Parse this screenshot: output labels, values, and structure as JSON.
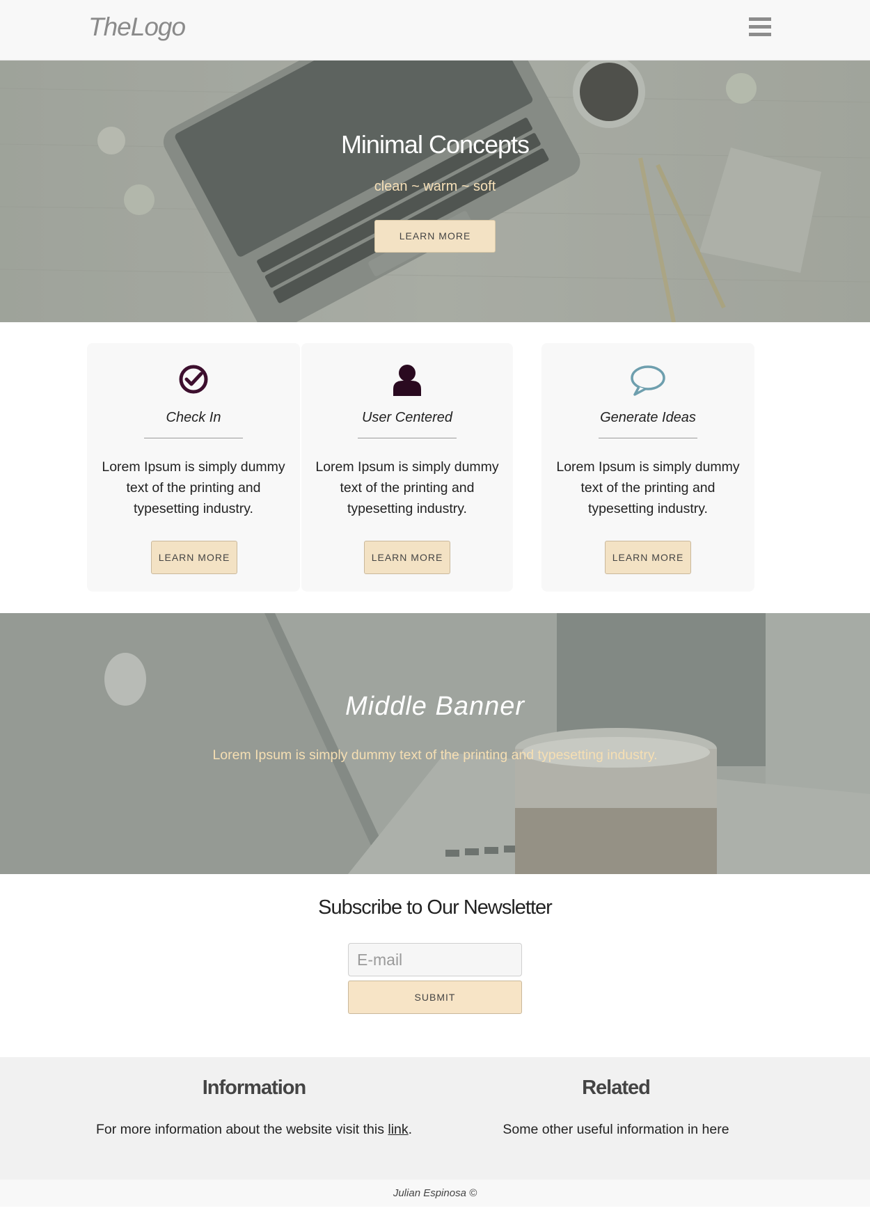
{
  "header": {
    "logo": "TheLogo",
    "menu_icon": "hamburger-menu-icon"
  },
  "hero": {
    "title": "Minimal Concepts",
    "subtitle": "clean ~ warm ~ soft",
    "button_label": "LEARN MORE"
  },
  "features": [
    {
      "icon": "check-circle-icon",
      "title": "Check In",
      "text": "Lorem Ipsum is simply dummy text of the printing and typesetting industry.",
      "button_label": "LEARN MORE"
    },
    {
      "icon": "user-icon",
      "title": "User Centered",
      "text": "Lorem Ipsum is simply dummy text of the printing and typesetting industry.",
      "button_label": "LEARN MORE"
    },
    {
      "icon": "speech-bubble-icon",
      "title": "Generate Ideas",
      "text": "Lorem Ipsum is simply dummy text of the printing and typesetting industry.",
      "button_label": "LEARN MORE"
    }
  ],
  "middle_banner": {
    "title": "Middle Banner",
    "text": "Lorem Ipsum is simply dummy text of the printing and typesetting industry."
  },
  "newsletter": {
    "title": "Subscribe to Our Newsletter",
    "email_placeholder": "E-mail",
    "submit_label": "SUBMIT"
  },
  "footer": {
    "info_heading": "Information",
    "info_text": "For more information about the website visit this ",
    "info_link": "link",
    "info_after": ".",
    "related_heading": "Related",
    "related_text": "Some other useful information in here",
    "copyright": "Julian Espinosa ©"
  },
  "colors": {
    "accent_button": "#f3e2c4",
    "check_icon": "#3d0f2e",
    "user_icon": "#2a0a20",
    "bubble_icon": "#6e9fae",
    "hero_subtitle": "#f6e0b8"
  }
}
